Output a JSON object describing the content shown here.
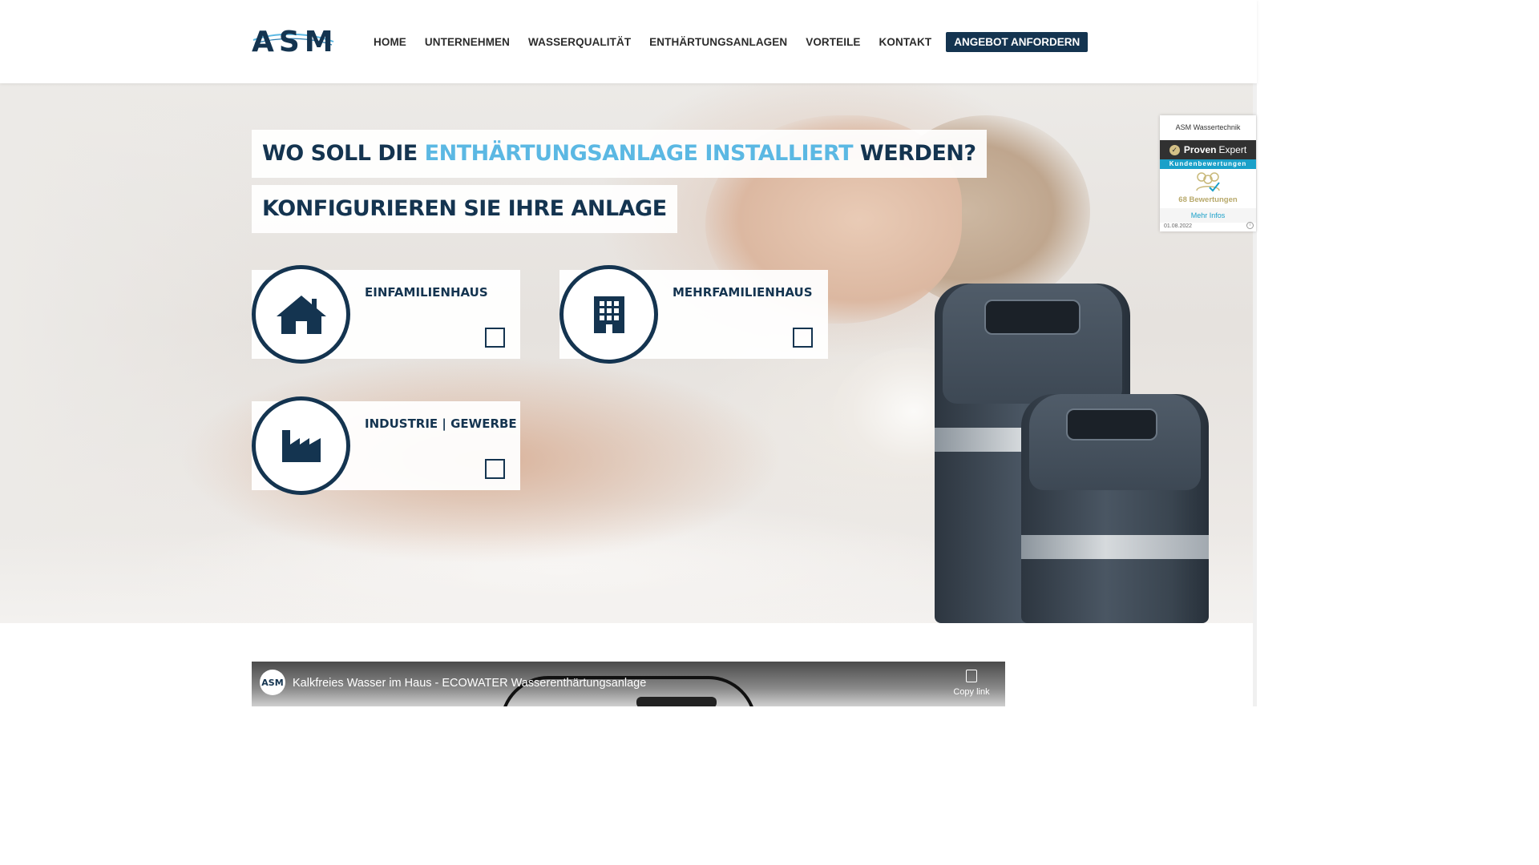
{
  "logo": {
    "text": "ASM"
  },
  "nav": {
    "items": [
      "HOME",
      "UNTERNEHMEN",
      "WASSERQUALITÄT",
      "ENTHÄRTUNGSANLAGEN",
      "VORTEILE",
      "KONTAKT"
    ],
    "cta": "ANGEBOT ANFORDERN"
  },
  "hero": {
    "headline_part1": "WO SOLL DIE ",
    "headline_accent": "ENTHÄRTUNGSANLAGE INSTALLIERT",
    "headline_part2": " WERDEN?",
    "subheadline": "KONFIGURIEREN SIE IHRE ANLAGE",
    "product_brand": "ECOWATER"
  },
  "options": [
    {
      "label": "EINFAMILIENHAUS",
      "icon": "house-icon",
      "checked": false
    },
    {
      "label": "MEHRFAMILIENHAUS",
      "icon": "building-icon",
      "checked": false
    },
    {
      "label": "INDUSTRIE | GEWERBE",
      "icon": "factory-icon",
      "checked": false
    }
  ],
  "proven_expert": {
    "company": "ASM Wassertechnik",
    "brand_bold": "Proven",
    "brand_rest": "Expert",
    "subtitle": "Kundenbewertungen",
    "count": "68 Bewertungen",
    "more": "Mehr Infos",
    "date": "01.08.2022"
  },
  "video": {
    "channel_avatar": "ASM",
    "title": "Kalkfreies Wasser im Haus - ECOWATER Wasserenthärtungsanlage",
    "copy_label": "Copy link"
  },
  "colors": {
    "primary": "#143450",
    "accent": "#5bb8e3",
    "proven_teal": "#1aa0c9"
  }
}
